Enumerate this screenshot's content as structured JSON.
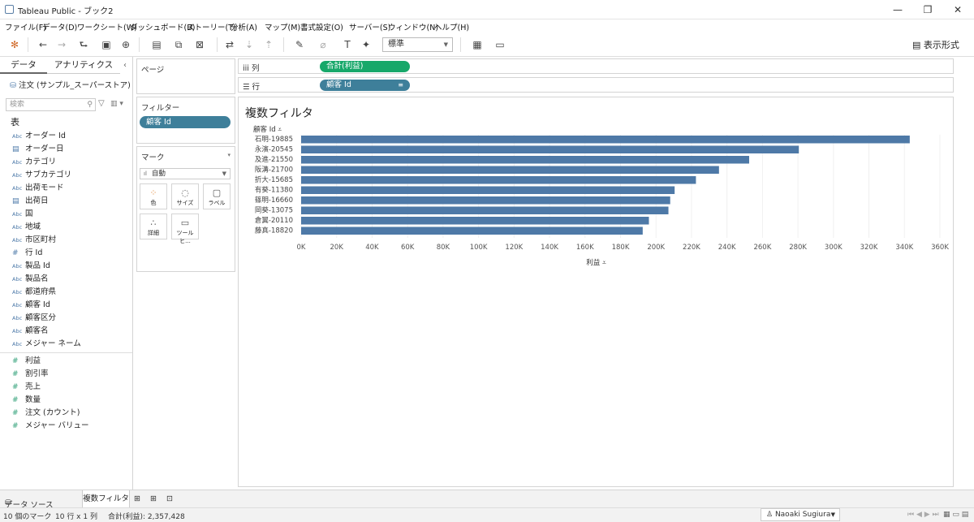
{
  "window": {
    "title": "Tableau Public - ブック2",
    "minimize": "—",
    "restore": "❐",
    "close": "✕"
  },
  "menu": [
    "ファイル(F)",
    "データ(D)",
    "ワークシート(W)",
    "ダッシュボード(B)",
    "ストーリー(T)",
    "分析(A)",
    "マップ(M)",
    "書式設定(O)",
    "サーバー(S)",
    "ウィンドウ(N)",
    "ヘルプ(H)"
  ],
  "toolbar": {
    "fit_select": "標準",
    "show_me": "表示形式"
  },
  "left_pane": {
    "tab_data": "データ",
    "tab_analytics": "アナリティクス",
    "collapse": "‹",
    "datasource": "注文 (サンプル_スーパーストア)",
    "search_placeholder": "検索",
    "table_header": "表",
    "dimensions": [
      {
        "type": "Abc",
        "label": "オーダー Id"
      },
      {
        "type": "date",
        "label": "オーダー日"
      },
      {
        "type": "Abc",
        "label": "カテゴリ"
      },
      {
        "type": "Abc",
        "label": "サブカテゴリ"
      },
      {
        "type": "Abc",
        "label": "出荷モード"
      },
      {
        "type": "date",
        "label": "出荷日"
      },
      {
        "type": "Abc",
        "label": "国"
      },
      {
        "type": "Abc",
        "label": "地域"
      },
      {
        "type": "Abc",
        "label": "市区町村"
      },
      {
        "type": "#",
        "label": "行 Id"
      },
      {
        "type": "Abc",
        "label": "製品 Id"
      },
      {
        "type": "Abc",
        "label": "製品名"
      },
      {
        "type": "Abc",
        "label": "都道府県"
      },
      {
        "type": "Abc",
        "label": "顧客 Id"
      },
      {
        "type": "Abc",
        "label": "顧客区分"
      },
      {
        "type": "Abc",
        "label": "顧客名"
      },
      {
        "type": "Abc",
        "label": "メジャー ネーム"
      }
    ],
    "measures": [
      {
        "type": "#",
        "label": "利益"
      },
      {
        "type": "#",
        "label": "割引率"
      },
      {
        "type": "#",
        "label": "売上"
      },
      {
        "type": "#",
        "label": "数量"
      },
      {
        "type": "#",
        "label": "注文 (カウント)"
      },
      {
        "type": "#",
        "label": "メジャー バリュー"
      }
    ]
  },
  "cards": {
    "pages": "ページ",
    "filters": "フィルター",
    "filter_pill": "顧客 Id",
    "marks": "マーク",
    "mark_type": "自動",
    "mark_buttons": [
      {
        "icon": "color-icon",
        "label": "色"
      },
      {
        "icon": "size-icon",
        "label": "サイズ"
      },
      {
        "icon": "label-icon",
        "label": "ラベル"
      },
      {
        "icon": "detail-icon",
        "label": "詳細"
      },
      {
        "icon": "tooltip-icon",
        "label": "ツールヒ..."
      }
    ]
  },
  "shelves": {
    "columns_label": "列",
    "columns_pill": "合計(利益)",
    "rows_label": "行",
    "rows_pill": "顧客 Id"
  },
  "viz": {
    "title": "複数フィルタ"
  },
  "chart_data": {
    "type": "bar",
    "orientation": "horizontal",
    "row_header": "顧客 Id",
    "xlabel": "利益",
    "categories": [
      "石明-19885",
      "永濱-20545",
      "及進-21550",
      "阪溝-21700",
      "折大-15685",
      "有葵-11380",
      "篠明-16660",
      "岡葵-13075",
      "倉翼-20110",
      "藤真-18820"
    ],
    "values": [
      343000,
      280500,
      252500,
      235500,
      222500,
      210500,
      208000,
      207000,
      196000,
      192500
    ],
    "xlim": [
      0,
      360000
    ],
    "xticks": [
      0,
      20000,
      40000,
      60000,
      80000,
      100000,
      120000,
      140000,
      160000,
      180000,
      200000,
      220000,
      240000,
      260000,
      280000,
      300000,
      320000,
      340000,
      360000
    ],
    "xtick_labels": [
      "0K",
      "20K",
      "40K",
      "60K",
      "80K",
      "100K",
      "120K",
      "140K",
      "160K",
      "180K",
      "200K",
      "220K",
      "240K",
      "260K",
      "280K",
      "300K",
      "320K",
      "340K",
      "360K"
    ],
    "bar_color": "#4e79a7",
    "grid": "vertical"
  },
  "bottom": {
    "datasource_tab": "データ ソース",
    "sheet_tab": "複数フィルタ"
  },
  "status": {
    "marks": "10 個のマーク",
    "shape": "10 行 x 1 列",
    "sum": "合計(利益): 2,357,428",
    "user": "Naoaki Sugiura"
  }
}
